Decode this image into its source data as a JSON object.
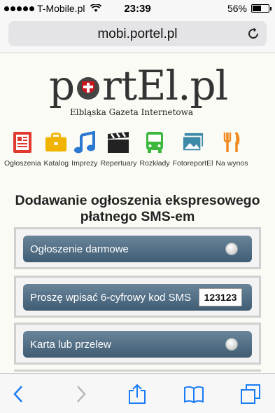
{
  "status_bar": {
    "carrier": "T-Mobile.pl",
    "time": "23:39",
    "battery_percent": "56%",
    "battery_level": 0.56
  },
  "browser": {
    "url": "mobi.portel.pl"
  },
  "logo": {
    "main_prefix": "p",
    "main_suffix": "rtEl.pl",
    "tagline": "Elbląska Gazeta Internetowa"
  },
  "menu": {
    "items": [
      {
        "label": "Ogłoszenia",
        "icon": "newspaper-icon",
        "color": "#e03a2f"
      },
      {
        "label": "Katalog",
        "icon": "briefcase-icon",
        "color": "#f0b400"
      },
      {
        "label": "Imprezy",
        "icon": "music-note-icon",
        "color": "#2a78d0"
      },
      {
        "label": "Repertuary",
        "icon": "clapperboard-icon",
        "color": "#222222"
      },
      {
        "label": "Rozkłady",
        "icon": "bus-icon",
        "color": "#3cb83c"
      },
      {
        "label": "FotoreportEl",
        "icon": "photos-icon",
        "color": "#3c8aa8"
      },
      {
        "label": "Na wynos",
        "icon": "fork-knife-icon",
        "color": "#f08a20"
      }
    ]
  },
  "form": {
    "title": "Dodawanie ogłoszenia ekspresowego płatnego SMS-em",
    "options": {
      "free": {
        "label": "Ogłoszenie darmowe"
      },
      "sms": {
        "label": "Proszę wpisać 6-cyfrowy kod SMS",
        "code_value": "123123"
      },
      "card": {
        "label": "Karta lub przelew"
      }
    }
  },
  "colors": {
    "button_top": "#6a859a",
    "button_bottom": "#3f5c73",
    "logo_red": "#c9151e",
    "ios_blue": "#1a7cf5"
  }
}
